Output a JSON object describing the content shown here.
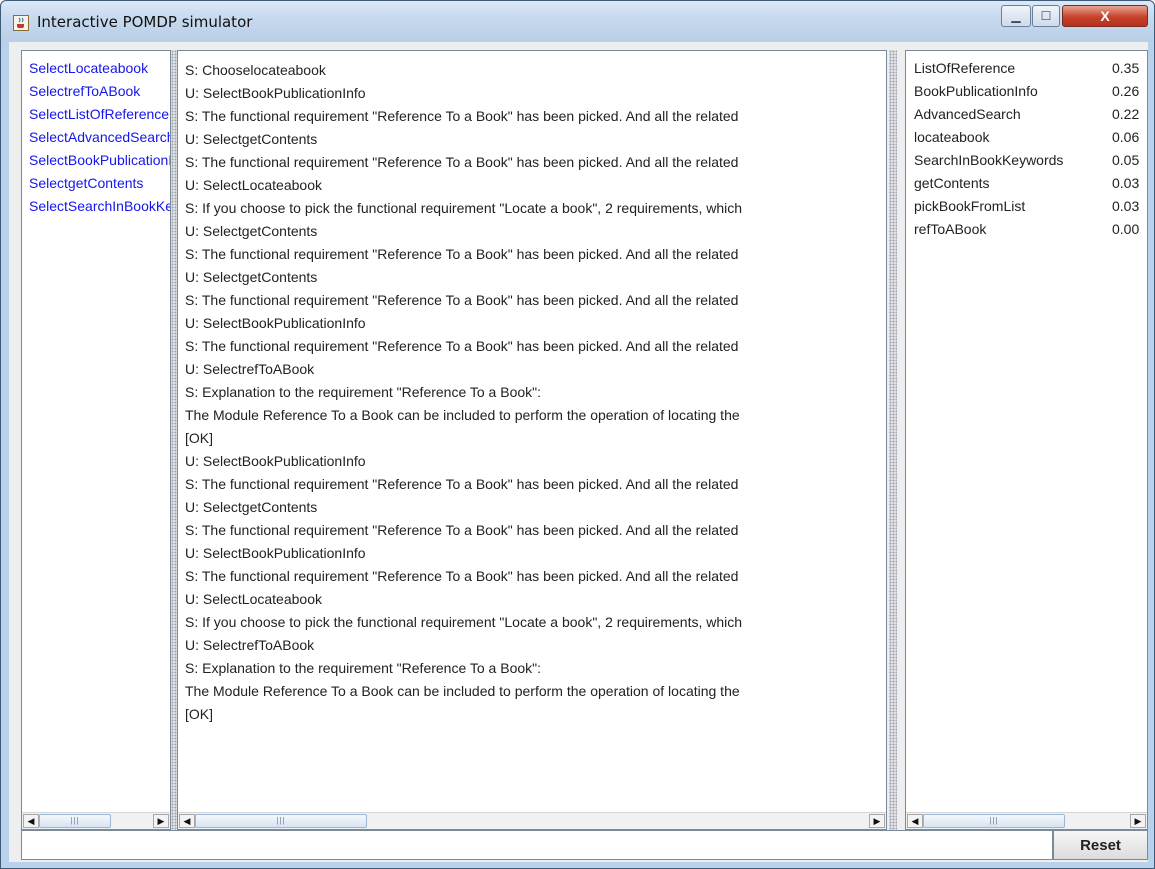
{
  "window": {
    "title": "Interactive POMDP simulator",
    "minimize_glyph": "▁",
    "maximize_glyph": "☐",
    "close_glyph": "X"
  },
  "actions": [
    {
      "label": "SelectLocateabook"
    },
    {
      "label": "SelectrefToABook"
    },
    {
      "label": "SelectListOfReference"
    },
    {
      "label": "SelectAdvancedSearch"
    },
    {
      "label": "SelectBookPublicationInfo"
    },
    {
      "label": "SelectgetContents"
    },
    {
      "label": "SelectSearchInBookKeywords"
    }
  ],
  "dialog_log": [
    "S: Chooselocateabook",
    "U: SelectBookPublicationInfo",
    "S: The functional requirement \"Reference To a Book\" has been picked. And all the related",
    "U: SelectgetContents",
    "S: The functional requirement \"Reference To a Book\" has been picked. And all the related",
    "U: SelectLocateabook",
    "S: If you choose to pick the functional requirement \"Locate a book\", 2 requirements, which",
    "U: SelectgetContents",
    "S: The functional requirement \"Reference To a Book\" has been picked. And all the related",
    "U: SelectgetContents",
    "S: The functional requirement \"Reference To a Book\" has been picked. And all the related",
    "U: SelectBookPublicationInfo",
    "S: The functional requirement \"Reference To a Book\" has been picked. And all the related",
    "U: SelectrefToABook",
    "S: Explanation to the requirement \"Reference To a Book\":",
    "The Module Reference To a Book can be included to perform the operation of locating the",
    "[OK]",
    "U: SelectBookPublicationInfo",
    "S: The functional requirement \"Reference To a Book\" has been picked. And all the related",
    "U: SelectgetContents",
    "S: The functional requirement \"Reference To a Book\" has been picked. And all the related",
    "U: SelectBookPublicationInfo",
    "S: The functional requirement \"Reference To a Book\" has been picked. And all the related",
    "U: SelectLocateabook",
    "S: If you choose to pick the functional requirement \"Locate a book\", 2 requirements, which",
    "U: SelectrefToABook",
    "S: Explanation to the requirement \"Reference To a Book\":",
    "The Module Reference To a Book can be included to perform the operation of locating the",
    "[OK]"
  ],
  "belief": [
    {
      "name": "ListOfReference",
      "value": "0.35"
    },
    {
      "name": "BookPublicationInfo",
      "value": "0.26"
    },
    {
      "name": "AdvancedSearch",
      "value": "0.22"
    },
    {
      "name": "locateabook",
      "value": "0.06"
    },
    {
      "name": "SearchInBookKeywords",
      "value": "0.05"
    },
    {
      "name": "getContents",
      "value": "0.03"
    },
    {
      "name": "pickBookFromList",
      "value": "0.03"
    },
    {
      "name": "refToABook",
      "value": "0.00"
    }
  ],
  "scroll": {
    "left_arrow": "◀",
    "right_arrow": "▶",
    "grip": "|||"
  },
  "input": {
    "value": ""
  },
  "reset_label": "Reset"
}
